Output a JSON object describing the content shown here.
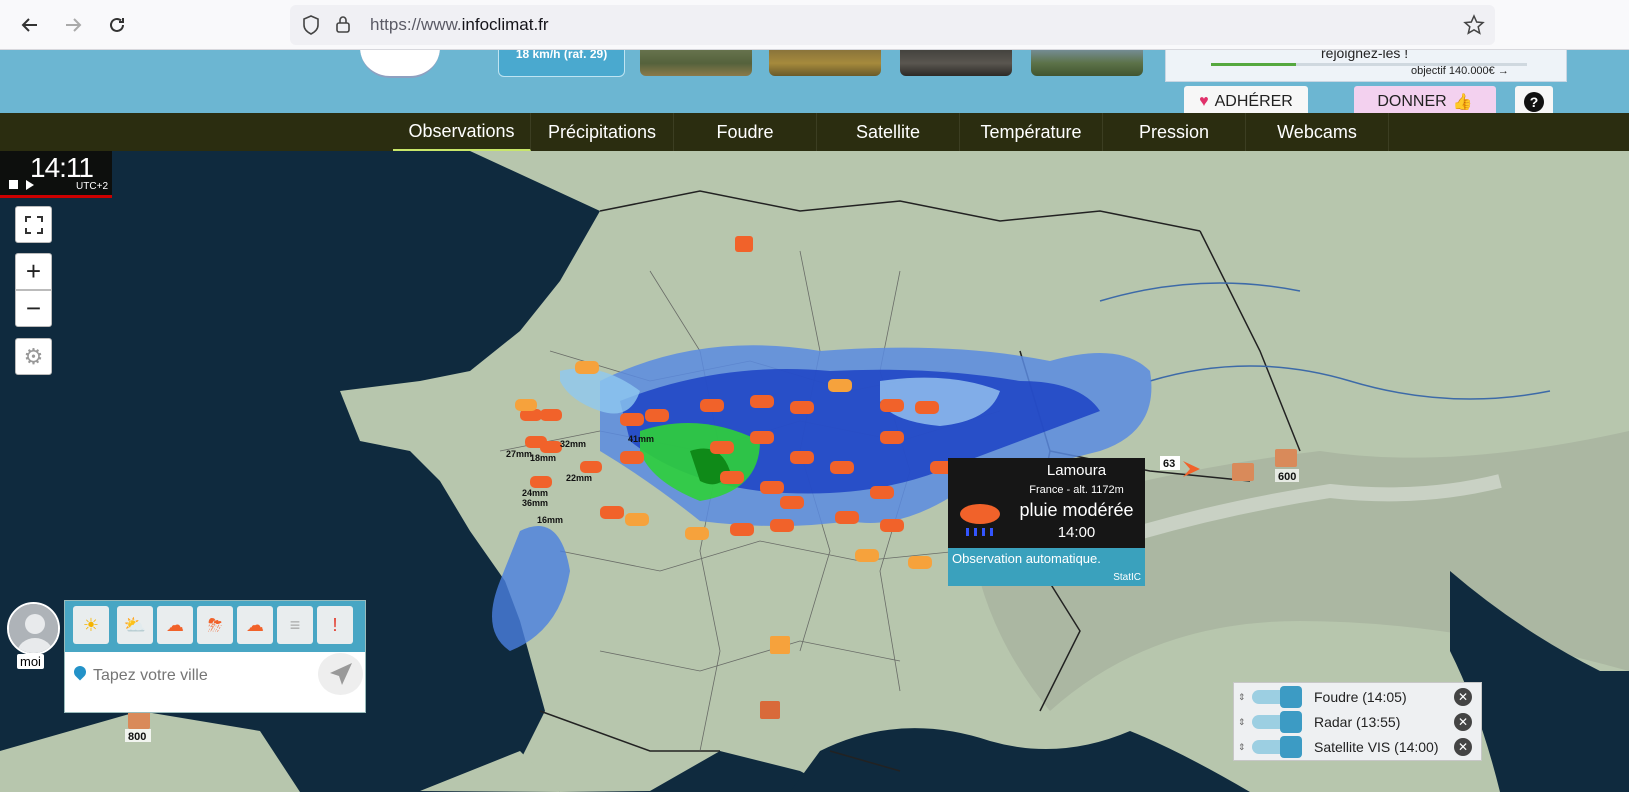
{
  "browser": {
    "url_prefix": "https://www.",
    "url_domain": "infoclimat.fr"
  },
  "header": {
    "wind_label": "18 km/h (raf. 29)",
    "promo_text": "rejoignez-les !",
    "promo_goal": "objectif 140.000€ →",
    "promo_progress": 0.27,
    "adherer_label": "ADHÉRER",
    "donner_label": "DONNER",
    "help_label": "?"
  },
  "nav": {
    "tabs": [
      "Observations",
      "Précipitations",
      "Foudre",
      "Satellite",
      "Température",
      "Pression",
      "Webcams"
    ],
    "active": "Observations"
  },
  "time": {
    "clock": "14:11",
    "tz": "UTC+2"
  },
  "map": {
    "zoom_in": "+",
    "zoom_out": "−",
    "labels": {
      "alt_63": "63",
      "alt_600": "600",
      "alt_800": "800",
      "mm_32": "32mm",
      "mm_41": "41mm",
      "mm_27": "27mm",
      "mm_18": "18mm",
      "mm_22": "22mm",
      "mm_24": "24mm",
      "mm_36": "36mm",
      "mm_16": "16mm"
    }
  },
  "popup": {
    "name": "Lamoura",
    "sub": "France - alt. 1172m",
    "condition": "pluie modérée",
    "time": "14:00",
    "footer": "Observation automatique.",
    "source": "StatIC"
  },
  "widget": {
    "me_label": "moi",
    "city_placeholder": "Tapez votre ville"
  },
  "layers": [
    {
      "label": "Foudre (14:05)"
    },
    {
      "label": "Radar (13:55)"
    },
    {
      "label": "Satellite VIS (14:00)"
    }
  ],
  "colors": {
    "navbar": "#2b2d10",
    "header": "#6cb6d2",
    "sea": "#0f2a3e",
    "land": "#b7c6ad",
    "accent": "#3aa1bd"
  }
}
